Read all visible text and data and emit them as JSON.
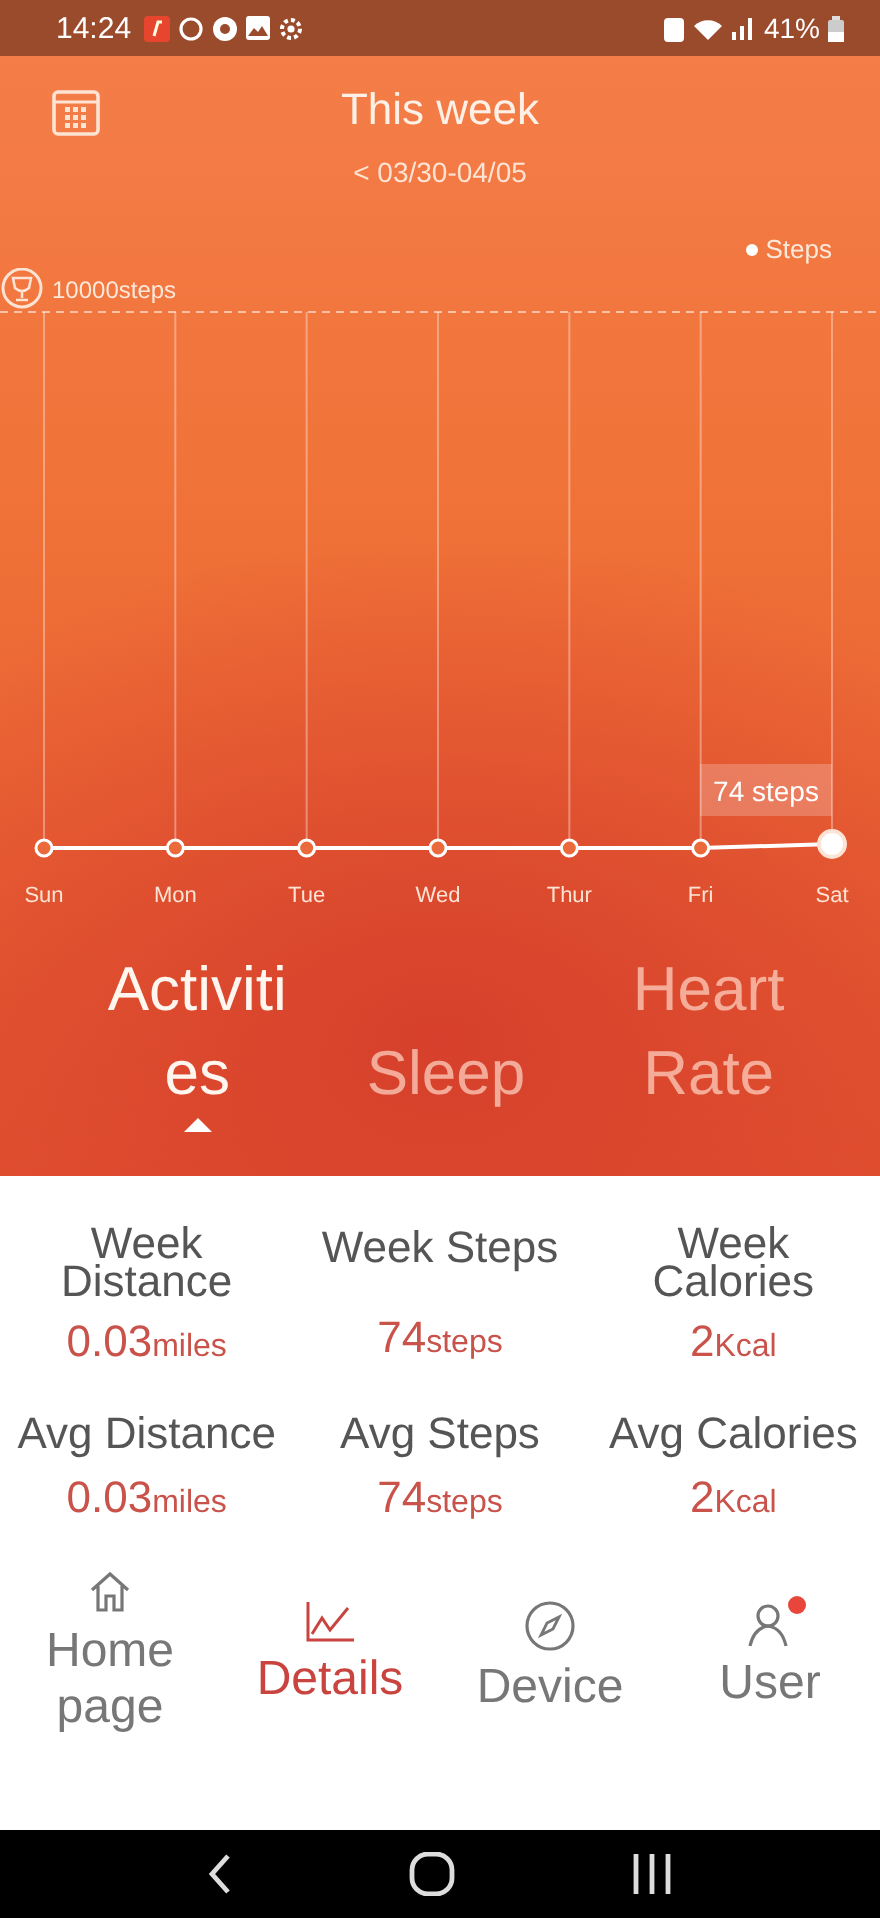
{
  "status_bar": {
    "time": "14:24",
    "battery": "41%"
  },
  "header": {
    "title": "This week",
    "range": "< 03/30-04/05"
  },
  "chart": {
    "legend": "Steps",
    "goal_label": "10000steps",
    "tooltip": "74 steps",
    "days": [
      "Sun",
      "Mon",
      "Tue",
      "Wed",
      "Thur",
      "Fri",
      "Sat"
    ]
  },
  "tabs": [
    {
      "label": "Activities",
      "selected": true
    },
    {
      "label": "Sleep",
      "selected": false
    },
    {
      "label": "Heart Rate",
      "selected": false
    }
  ],
  "metrics": [
    {
      "label": "Week Distance",
      "value": "0.03",
      "unit": "miles"
    },
    {
      "label": "Week Steps",
      "value": "74",
      "unit": "steps"
    },
    {
      "label": "Week Calories",
      "value": "2",
      "unit": "Kcal"
    },
    {
      "label": "Avg Distance",
      "value": "0.03",
      "unit": "miles"
    },
    {
      "label": "Avg Steps",
      "value": "74",
      "unit": "steps"
    },
    {
      "label": "Avg Calories",
      "value": "2",
      "unit": "Kcal"
    }
  ],
  "nav": [
    {
      "label": "Home page",
      "selected": false,
      "badge": false
    },
    {
      "label": "Details",
      "selected": true,
      "badge": false
    },
    {
      "label": "Device",
      "selected": false,
      "badge": false
    },
    {
      "label": "User",
      "selected": false,
      "badge": true
    }
  ]
}
